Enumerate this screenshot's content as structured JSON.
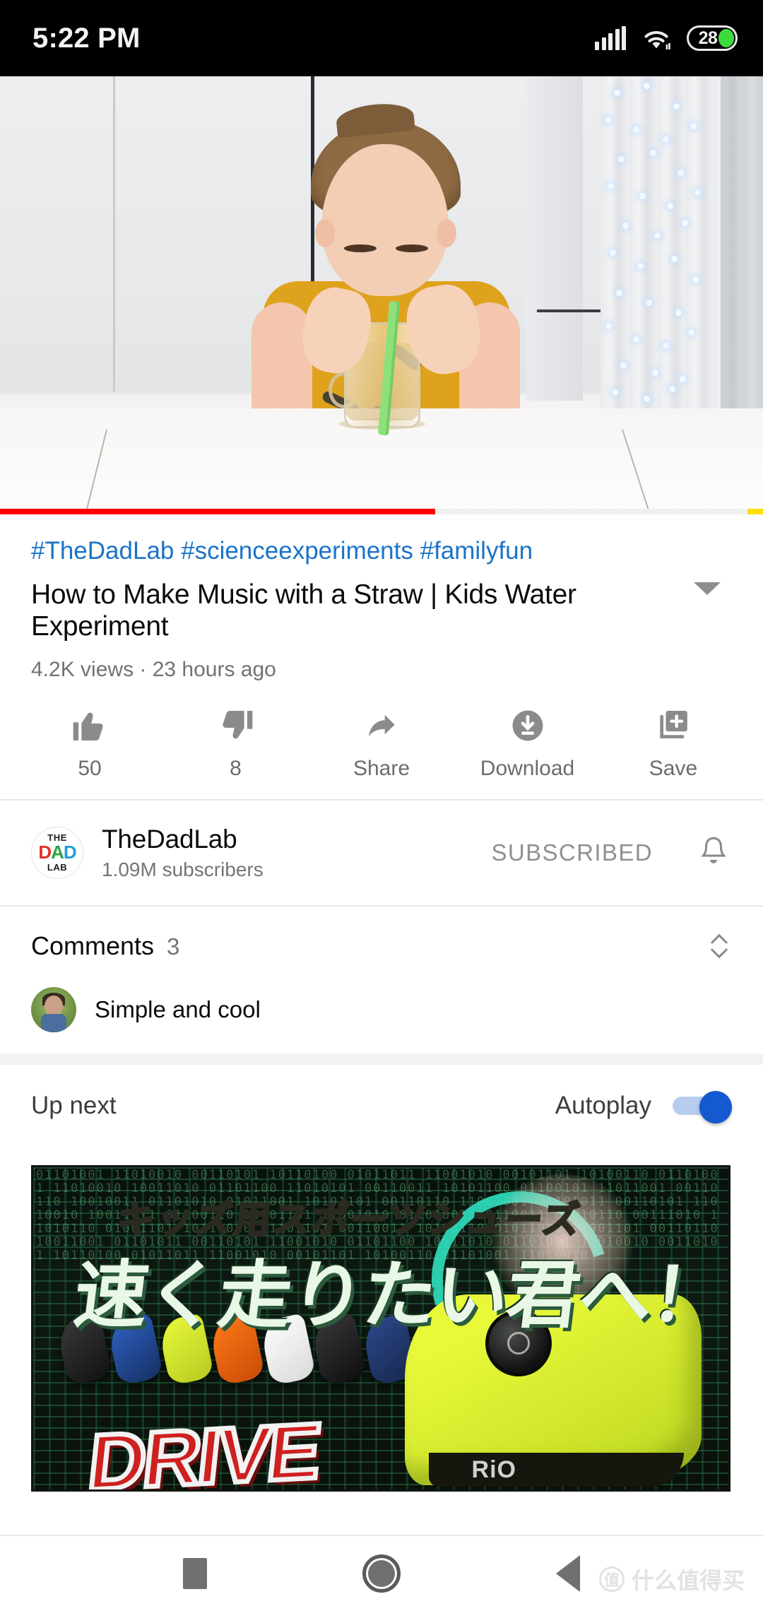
{
  "status_bar": {
    "time": "5:22 PM",
    "signal_icon": "signal-bars-icon",
    "wifi_icon": "wifi-icon",
    "battery_level": "28",
    "battery_color": "#3ddc3d"
  },
  "player": {
    "scene_description": "Boy in yellow t-shirt blowing into a green straw in a glass of water on a white table",
    "progress_percent": 57,
    "chapter_marker_percent": 98,
    "progress_color": "#ff0000",
    "chapter_color": "#ffe000"
  },
  "video": {
    "hashtags": "#TheDadLab #scienceexperiments #familyfun",
    "title": "How to Make Music with a Straw | Kids Water Experiment",
    "views_and_age": "4.2K views · 23 hours ago",
    "expand_icon": "chevron-down-icon"
  },
  "actions": [
    {
      "icon": "thumbs-up-icon",
      "label": "50"
    },
    {
      "icon": "thumbs-down-icon",
      "label": "8"
    },
    {
      "icon": "share-icon",
      "label": "Share"
    },
    {
      "icon": "download-icon",
      "label": "Download"
    },
    {
      "icon": "save-to-playlist-icon",
      "label": "Save"
    }
  ],
  "channel": {
    "avatar_icon": "channel-avatar-thedadlab",
    "avatar_text_top": "THE",
    "avatar_text_mid": [
      "D",
      "A",
      "D"
    ],
    "avatar_text_bottom": "LAB",
    "name": "TheDadLab",
    "subscribers": "1.09M subscribers",
    "subscribe_state_label": "SUBSCRIBED",
    "notification_icon": "bell-icon"
  },
  "comments": {
    "heading": "Comments",
    "count": "3",
    "sort_icon": "sort-up-down-icon",
    "top_comment": {
      "avatar_icon": "commenter-avatar",
      "text": "Simple and cool"
    }
  },
  "up_next": {
    "label": "Up next",
    "autoplay_label": "Autoplay",
    "autoplay_on": true,
    "toggle_color": "#1459cf"
  },
  "suggested_video": {
    "thumbnail_text_top": "キッズ用スポーツシューズ",
    "thumbnail_text_main": "速く走りたい君へ！",
    "thumbnail_text_logo": "DRIVE",
    "thumbnail_brand": "RiO",
    "thumbnail_description": "Japanese kids sports shoes ad with neon yellow sneaker, matrix-style green code background"
  },
  "nav_bar": {
    "recents_icon": "square-recents-icon",
    "home_icon": "circle-home-icon",
    "back_icon": "triangle-back-icon"
  },
  "watermark": {
    "mark": "值",
    "text": "什么值得买"
  }
}
